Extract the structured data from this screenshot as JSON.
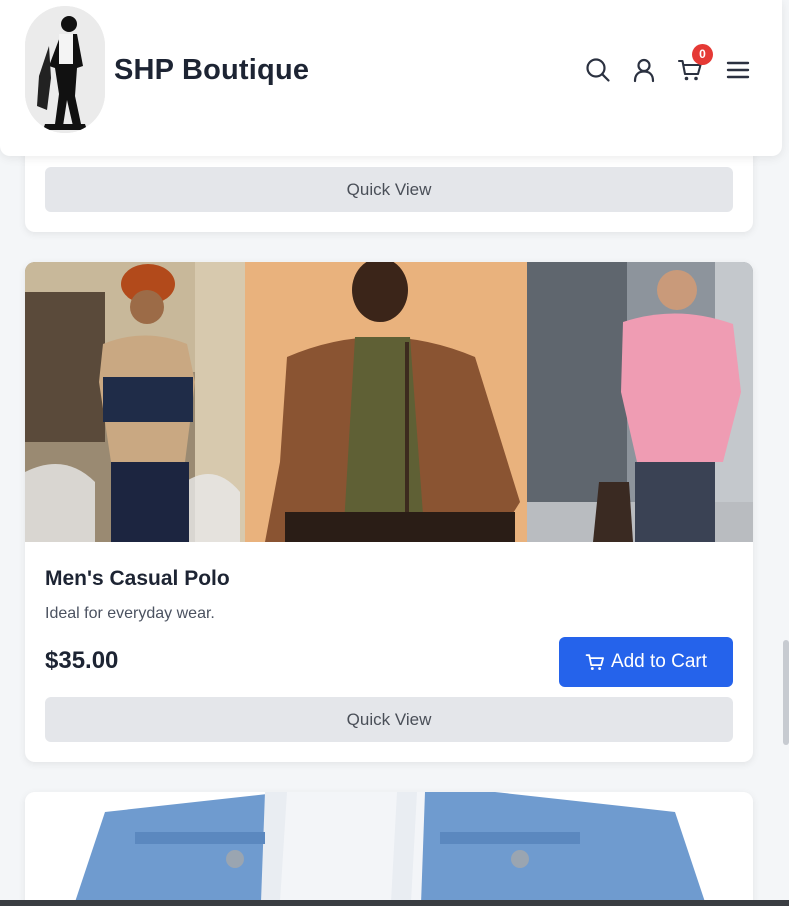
{
  "header": {
    "brand": "SHP Boutique",
    "cart_count": "0",
    "icons": [
      "search-icon",
      "user-icon",
      "cart-icon",
      "menu-icon"
    ]
  },
  "cards": [
    {
      "quick_view_label": "Quick View"
    },
    {
      "title": "Men's Casual Polo",
      "description": "Ideal for everyday wear.",
      "price": "$35.00",
      "add_to_cart_label": "Add to Cart",
      "quick_view_label": "Quick View"
    }
  ],
  "colors": {
    "accent": "#2563eb",
    "badge": "#e53935",
    "quick_view_bg": "#e4e6ea"
  }
}
